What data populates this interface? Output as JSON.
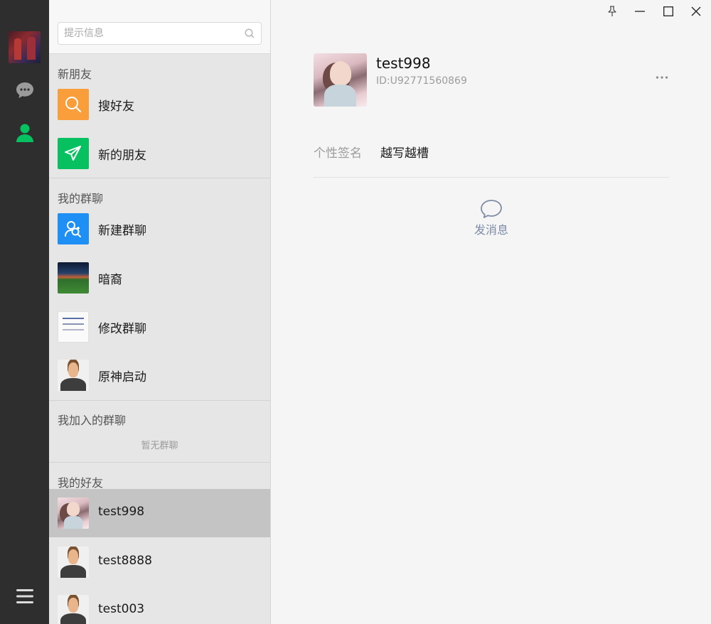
{
  "colors": {
    "rail_bg": "#2e2e2e",
    "accent_green": "#07c160",
    "search_orange": "#fa9d3b",
    "new_friend_green": "#07c160",
    "new_group_blue": "#1e8ff5",
    "selected_row": "#c4c4c4",
    "send_message_blue": "#7d8ca6"
  },
  "rail": {
    "icons": [
      "chat-bubble-icon",
      "contacts-person-icon",
      "hamburger-menu-icon"
    ]
  },
  "search": {
    "placeholder": "提示信息"
  },
  "sections": {
    "new_friends": {
      "title": "新朋友",
      "items": [
        {
          "label": "搜好友",
          "icon": "search-icon"
        },
        {
          "label": "新的朋友",
          "icon": "paper-plane-icon"
        }
      ]
    },
    "my_groups": {
      "title": "我的群聊",
      "items": [
        {
          "label": "新建群聊",
          "icon": "add-group-icon"
        },
        {
          "label": "暗裔"
        },
        {
          "label": "修改群聊"
        },
        {
          "label": "原神启动"
        }
      ]
    },
    "joined_groups": {
      "title": "我加入的群聊",
      "empty_text": "暂无群聊"
    },
    "my_friends": {
      "title": "我的好友",
      "items": [
        {
          "label": "test998",
          "selected": true
        },
        {
          "label": "test8888"
        },
        {
          "label": "test003"
        }
      ]
    }
  },
  "profile": {
    "name": "test998",
    "id": "ID:U92771560869",
    "signature_label": "个性签名",
    "signature_value": "越写越槽",
    "send_message_label": "发消息"
  }
}
